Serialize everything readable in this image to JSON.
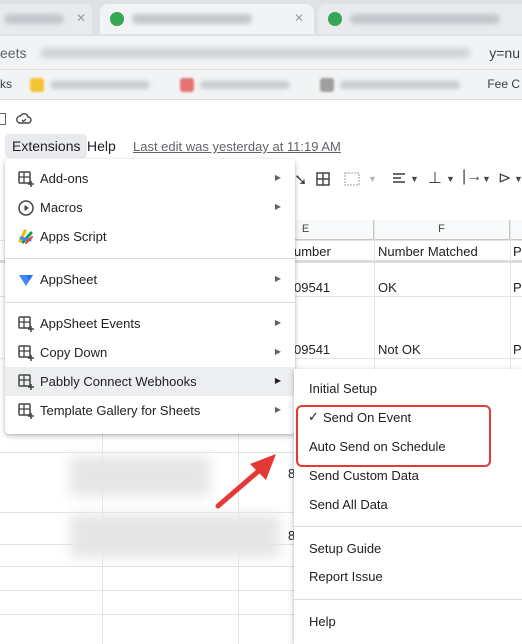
{
  "browser": {
    "url_left": "eets",
    "url_right": "y=nu",
    "bookmarks_left": "ks",
    "bookmarks_right": "Fee C"
  },
  "sheets": {
    "menu_extensions": "Extensions",
    "menu_help": "Help",
    "last_edit": "Last edit was yesterday at 11:19 AM"
  },
  "grid": {
    "columns": [
      {
        "letter": "E",
        "header": "umber"
      },
      {
        "letter": "F",
        "header": "Number Matched"
      },
      {
        "letter": "",
        "header": "P"
      }
    ],
    "rows": [
      {
        "e": "09541",
        "f": "OK",
        "g": "P"
      },
      {
        "e": "09541",
        "f": "Not OK",
        "g": "P"
      }
    ],
    "partial_values": [
      "8",
      "8"
    ]
  },
  "extensions_menu": {
    "items": [
      {
        "label": "Add-ons",
        "icon": "addons-icon",
        "submenu": true
      },
      {
        "label": "Macros",
        "icon": "play-circle-icon",
        "submenu": true
      },
      {
        "label": "Apps Script",
        "icon": "apps-script-icon",
        "submenu": false
      },
      {
        "label": "AppSheet",
        "icon": "appsheet-icon",
        "submenu": true
      },
      {
        "label": "AppSheet Events",
        "icon": "addon-grid-icon",
        "submenu": true
      },
      {
        "label": "Copy Down",
        "icon": "addon-grid-icon",
        "submenu": true
      },
      {
        "label": "Pabbly Connect Webhooks",
        "icon": "addon-grid-icon",
        "submenu": true
      },
      {
        "label": "Template Gallery for Sheets",
        "icon": "addon-grid-icon",
        "submenu": true
      }
    ]
  },
  "pabbly_submenu": {
    "items": [
      {
        "label": "Initial Setup"
      },
      {
        "label": "Send On Event",
        "checked": true
      },
      {
        "label": "Auto Send on Schedule"
      },
      {
        "label": "Send Custom Data"
      },
      {
        "label": "Send All Data"
      },
      {
        "label": "Setup Guide"
      },
      {
        "label": "Report Issue"
      },
      {
        "label": "Help"
      }
    ],
    "check_mark": "✓"
  },
  "colors": {
    "annotation_red": "#e53935",
    "hover_bg": "#edeef0",
    "menu_active_bg": "#e8eaed"
  }
}
